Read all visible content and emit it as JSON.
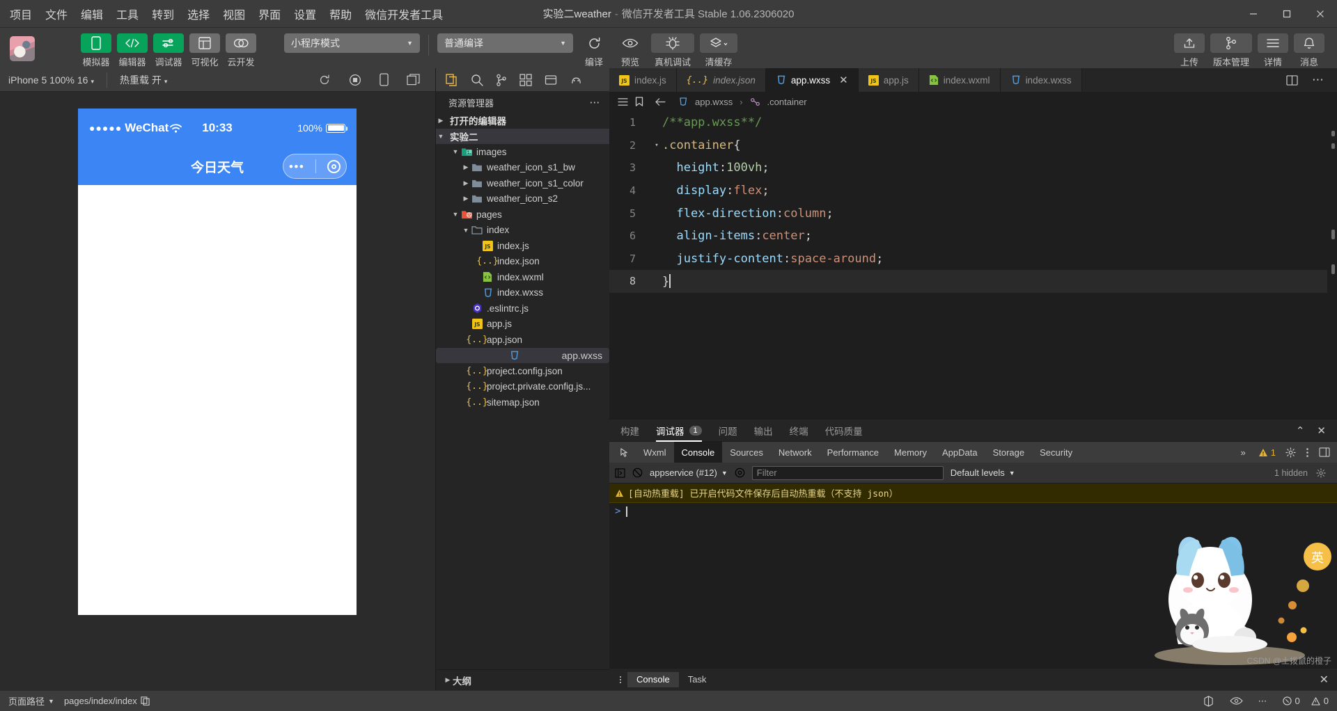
{
  "titlebar": {
    "menus": [
      "项目",
      "文件",
      "编辑",
      "工具",
      "转到",
      "选择",
      "视图",
      "界面",
      "设置",
      "帮助",
      "微信开发者工具"
    ],
    "project": "实验二weather",
    "dash": "-",
    "app": "微信开发者工具 Stable 1.06.2306020",
    "minimize": "–",
    "maximize": "□",
    "close": "✕"
  },
  "toolbar": {
    "left_buttons": [
      {
        "label": "模拟器",
        "icon": "phone-icon",
        "style": "green"
      },
      {
        "label": "编辑器",
        "icon": "code-icon",
        "style": "green"
      },
      {
        "label": "调试器",
        "icon": "sliders-icon",
        "style": "green"
      },
      {
        "label": "可视化",
        "icon": "layout-icon",
        "style": "grey"
      },
      {
        "label": "云开发",
        "icon": "cloud-icon",
        "style": "grey"
      }
    ],
    "mode_select": "小程序模式",
    "compile_select": "普通编译",
    "action_buttons": [
      {
        "label": "编译",
        "icon": "refresh-icon"
      },
      {
        "label": "预览",
        "icon": "eye-icon"
      },
      {
        "label": "真机调试",
        "icon": "bug-icon"
      },
      {
        "label": "清缓存",
        "icon": "layers-icon"
      }
    ],
    "right_buttons": [
      {
        "label": "上传",
        "icon": "upload-icon"
      },
      {
        "label": "版本管理",
        "icon": "branch-icon"
      },
      {
        "label": "详情",
        "icon": "menu-icon"
      },
      {
        "label": "消息",
        "icon": "bell-icon"
      }
    ]
  },
  "simulator": {
    "device": "iPhone 5 100% 16",
    "hot_reload": "热重载 开",
    "icons": [
      "refresh-icon",
      "record-icon",
      "phone-icon",
      "window-icon"
    ],
    "phone": {
      "carrier_dots": "●●●●●",
      "carrier": "WeChat",
      "wifi": "wifi-icon",
      "time": "10:33",
      "battery_text": "100%",
      "nav_title": "今日天气"
    }
  },
  "explorer": {
    "actions": [
      "files-icon",
      "search-icon",
      "branch-icon",
      "extensions-icon",
      "debug-icon",
      "npm-icon"
    ],
    "title": "资源管理器",
    "more": "⋯",
    "sections": [
      {
        "label": "打开的编辑器",
        "expanded": false
      },
      {
        "label": "实验二",
        "expanded": true
      }
    ],
    "tree": [
      {
        "label": "images",
        "indent": 1,
        "type": "folder-images",
        "arrow": "▾",
        "selected": false
      },
      {
        "label": "weather_icon_s1_bw",
        "indent": 2,
        "type": "folder",
        "arrow": "▸",
        "selected": false
      },
      {
        "label": "weather_icon_s1_color",
        "indent": 2,
        "type": "folder",
        "arrow": "▸",
        "selected": false
      },
      {
        "label": "weather_icon_s2",
        "indent": 2,
        "type": "folder",
        "arrow": "▸",
        "selected": false
      },
      {
        "label": "pages",
        "indent": 1,
        "type": "folder-pages",
        "arrow": "▾",
        "selected": false
      },
      {
        "label": "index",
        "indent": 2,
        "type": "folder-open",
        "arrow": "▾",
        "selected": false
      },
      {
        "label": "index.js",
        "indent": 3,
        "type": "js",
        "arrow": "",
        "selected": false
      },
      {
        "label": "index.json",
        "indent": 3,
        "type": "json",
        "arrow": "",
        "selected": false
      },
      {
        "label": "index.wxml",
        "indent": 3,
        "type": "wxml",
        "arrow": "",
        "selected": false
      },
      {
        "label": "index.wxss",
        "indent": 3,
        "type": "wxss",
        "arrow": "",
        "selected": false
      },
      {
        "label": ".eslintrc.js",
        "indent": 2,
        "type": "eslint",
        "arrow": "",
        "selected": false
      },
      {
        "label": "app.js",
        "indent": 2,
        "type": "js",
        "arrow": "",
        "selected": false
      },
      {
        "label": "app.json",
        "indent": 2,
        "type": "json",
        "arrow": "",
        "selected": false
      },
      {
        "label": "app.wxss",
        "indent": 2,
        "type": "wxss",
        "arrow": "",
        "selected": true
      },
      {
        "label": "project.config.json",
        "indent": 2,
        "type": "json",
        "arrow": "",
        "selected": false
      },
      {
        "label": "project.private.config.js...",
        "indent": 2,
        "type": "json",
        "arrow": "",
        "selected": false
      },
      {
        "label": "sitemap.json",
        "indent": 2,
        "type": "json",
        "arrow": "",
        "selected": false
      }
    ],
    "outline": "大纲"
  },
  "editor": {
    "tabs": [
      {
        "label": "index.js",
        "type": "js",
        "active": false,
        "italic": false,
        "close": false
      },
      {
        "label": "index.json",
        "type": "json",
        "active": false,
        "italic": true,
        "close": false
      },
      {
        "label": "app.wxss",
        "type": "wxss",
        "active": true,
        "italic": false,
        "close": true
      },
      {
        "label": "app.js",
        "type": "js",
        "active": false,
        "italic": false,
        "close": false
      },
      {
        "label": "index.wxml",
        "type": "wxml",
        "active": false,
        "italic": false,
        "close": false
      },
      {
        "label": "index.wxss",
        "type": "wxss",
        "active": false,
        "italic": false,
        "close": false
      }
    ],
    "tab_more": "⋯",
    "breadcrumb": {
      "file": "app.wxss",
      "sep": "›",
      "symbol": ".container"
    },
    "lines": [
      {
        "n": "1",
        "fold": "",
        "segs": [
          {
            "t": "/**app.wxss**/",
            "c": "cm"
          }
        ]
      },
      {
        "n": "2",
        "fold": "▾",
        "segs": [
          {
            "t": ".container",
            "c": "sel1"
          },
          {
            "t": "{",
            "c": "punc"
          }
        ]
      },
      {
        "n": "3",
        "fold": "",
        "segs": [
          {
            "t": "  height",
            "c": "prop"
          },
          {
            "t": ":",
            "c": "punc"
          },
          {
            "t": "100vh",
            "c": "num"
          },
          {
            "t": ";",
            "c": "punc"
          }
        ]
      },
      {
        "n": "4",
        "fold": "",
        "segs": [
          {
            "t": "  display",
            "c": "prop"
          },
          {
            "t": ":",
            "c": "punc"
          },
          {
            "t": "flex",
            "c": "val"
          },
          {
            "t": ";",
            "c": "punc"
          }
        ]
      },
      {
        "n": "5",
        "fold": "",
        "segs": [
          {
            "t": "  flex-direction",
            "c": "prop"
          },
          {
            "t": ":",
            "c": "punc"
          },
          {
            "t": "column",
            "c": "val"
          },
          {
            "t": ";",
            "c": "punc"
          }
        ]
      },
      {
        "n": "6",
        "fold": "",
        "segs": [
          {
            "t": "  align-items",
            "c": "prop"
          },
          {
            "t": ":",
            "c": "punc"
          },
          {
            "t": "center",
            "c": "val"
          },
          {
            "t": ";",
            "c": "punc"
          }
        ]
      },
      {
        "n": "7",
        "fold": "",
        "segs": [
          {
            "t": "  justify-content",
            "c": "prop"
          },
          {
            "t": ":",
            "c": "punc"
          },
          {
            "t": "space-around",
            "c": "val"
          },
          {
            "t": ";",
            "c": "punc"
          }
        ]
      },
      {
        "n": "8",
        "fold": "",
        "segs": [
          {
            "t": "}",
            "c": "punc"
          }
        ],
        "current": true
      }
    ]
  },
  "devtools": {
    "panel_tabs": [
      {
        "label": "构建",
        "active": false,
        "badge": null
      },
      {
        "label": "调试器",
        "active": true,
        "badge": "1"
      },
      {
        "label": "问题",
        "active": false,
        "badge": null
      },
      {
        "label": "输出",
        "active": false,
        "badge": null
      },
      {
        "label": "终端",
        "active": false,
        "badge": null
      },
      {
        "label": "代码质量",
        "active": false,
        "badge": null
      }
    ],
    "panel_collapse": "⌃",
    "panel_close": "✕",
    "cdt_tabs": [
      "Wxml",
      "Console",
      "Sources",
      "Network",
      "Performance",
      "Memory",
      "AppData",
      "Storage",
      "Security"
    ],
    "cdt_active": "Console",
    "cdt_overflow": "»",
    "warn_count": "1",
    "settings_icon": "gear-icon",
    "more_icon": "kebab-icon",
    "dock_icon": "dock-icon",
    "context": "appservice (#12)",
    "filter_placeholder": "Filter",
    "levels": "Default levels",
    "hidden": "1 hidden",
    "message": "[自动热重载] 已开启代码文件保存后自动热重载（不支持 json）",
    "prompt": ">",
    "drawer_tabs": [
      {
        "label": "Console",
        "active": true
      },
      {
        "label": "Task",
        "active": false
      }
    ],
    "drawer_close": "✕"
  },
  "status": {
    "page_path_label": "页面路径",
    "page_path": "pages/index/index",
    "copy_icon": "copy-icon",
    "errors": "0",
    "warnings": "0",
    "right_icons": [
      "network-icon",
      "eye-icon",
      "more-icon"
    ]
  },
  "watermark": {
    "text": "CSDN @土拨鼠的橙子"
  },
  "colors": {
    "green": "#07a35a",
    "blue": "#3b85f5",
    "titlebar": "#3c3c3c",
    "editor_bg": "#1e1e1e",
    "accent_yellow": "#e2b338"
  }
}
